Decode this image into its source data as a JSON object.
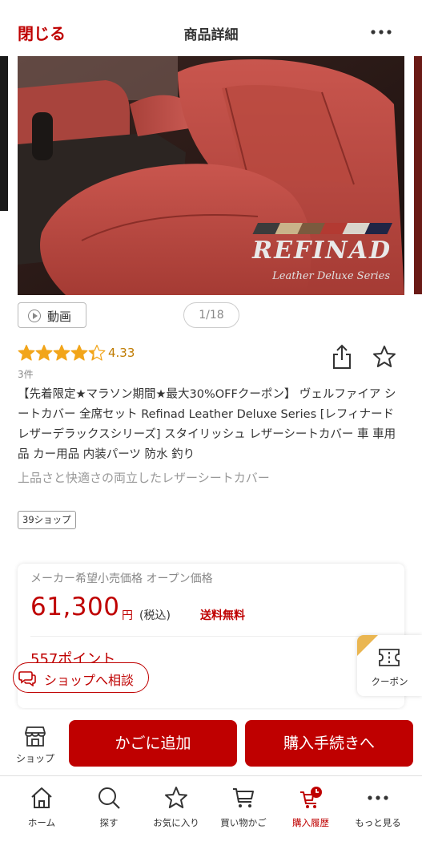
{
  "header": {
    "close_label": "閉じる",
    "title": "商品詳細",
    "more_icon": "more-dots-icon"
  },
  "gallery": {
    "brand_logo": "REFINAD",
    "brand_subtitle": "Leather Deluxe Series",
    "video_label": "動画",
    "counter": "1/18",
    "seat_color": "#b94a44"
  },
  "rating": {
    "value": "4.33",
    "stars": 4.33,
    "review_count": "3件"
  },
  "product": {
    "title": "【先着限定★マラソン期間★最大30%OFFクーポン】 ヴェルファイア シートカバー 全席セット Refinad Leather Deluxe Series [レフィナード レザーデラックスシリーズ] スタイリッシュ レザーシートカバー 車 車用品 カー用品 内装パーツ 防水 釣り",
    "subtitle": "上品さと快適さの両立したレザーシートカバー",
    "shop_badge": "39ショップ"
  },
  "price": {
    "msrp_label": "メーカー希望小売価格 オープン価格",
    "amount": "61,300",
    "yen": "円",
    "tax": "(税込)",
    "shipping": "送料無料",
    "points": "557ポイント"
  },
  "consult": {
    "label": "ショップへ相談"
  },
  "coupon": {
    "label": "クーポン"
  },
  "purchase": {
    "shop_label": "ショップ",
    "add_to_cart": "かごに追加",
    "buy_now": "購入手続きへ"
  },
  "nav": {
    "items": [
      {
        "label": "ホーム",
        "icon": "home-icon"
      },
      {
        "label": "探す",
        "icon": "search-icon"
      },
      {
        "label": "お気に入り",
        "icon": "star-icon"
      },
      {
        "label": "買い物かご",
        "icon": "cart-icon"
      },
      {
        "label": "購入履歴",
        "icon": "purchase-history-icon"
      },
      {
        "label": "もっと見る",
        "icon": "more-icon"
      }
    ]
  },
  "colors": {
    "brand_red": "#bf0000",
    "star_gold": "#f2a51a",
    "coupon_gold": "#eab651"
  }
}
